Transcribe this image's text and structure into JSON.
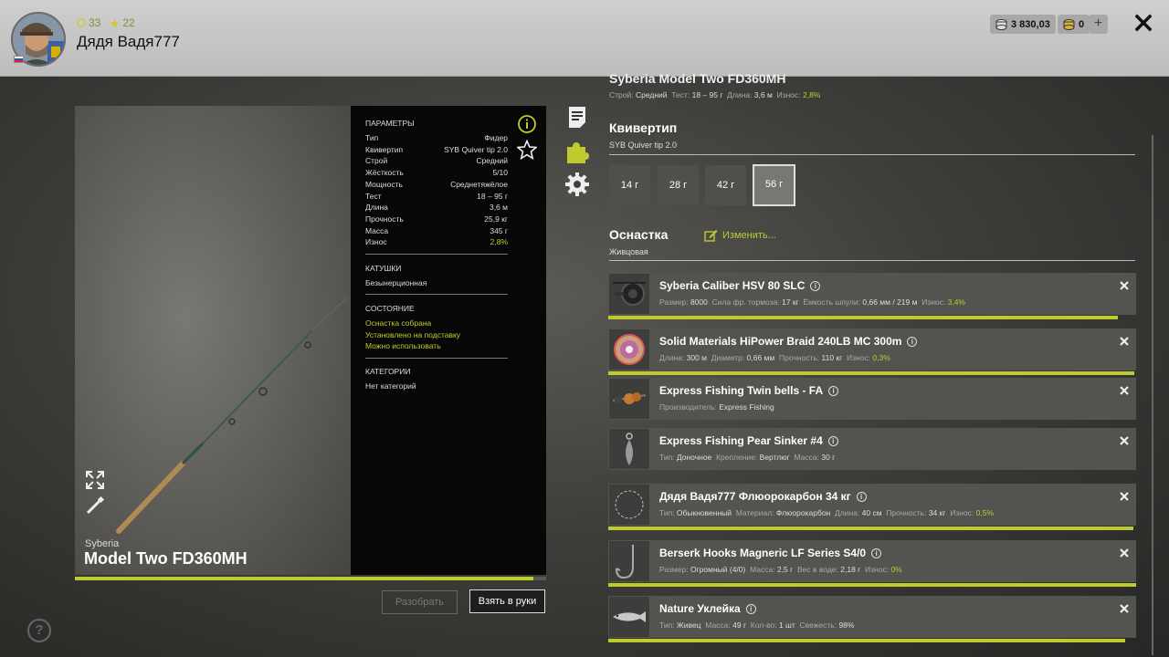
{
  "profile": {
    "username": "Дядя Вадя777",
    "level": "33",
    "rank": "22"
  },
  "currency": {
    "silver": "3 830,03",
    "gold": "0"
  },
  "rod": {
    "brand": "Syberia",
    "model": "Model Two FD360MH",
    "full_title": "Syberia Model Two FD360MH",
    "condition_fraction": 0.972,
    "meta": {
      "stroy_label": "Строй:",
      "stroy_value": "Средний",
      "test_label": "Тест:",
      "test_value": "18 – 95 г",
      "length_label": "Длина:",
      "length_value": "3,6 м",
      "wear_label": "Износ:",
      "wear_value": "2,8%"
    }
  },
  "params": {
    "title": "ПАРАМЕТРЫ",
    "rows": [
      {
        "k": "Тип",
        "v": "Фидер"
      },
      {
        "k": "Квивертип",
        "v": "SYB Quiver tip 2.0"
      },
      {
        "k": "Строй",
        "v": "Средний"
      },
      {
        "k": "Жёсткость",
        "v": "5/10"
      },
      {
        "k": "Мощность",
        "v": "Среднетяжёлое"
      },
      {
        "k": "Тест",
        "v": "18 – 95 г"
      },
      {
        "k": "Длина",
        "v": "3,6 м"
      },
      {
        "k": "Прочность",
        "v": "25,9 кг"
      },
      {
        "k": "Масса",
        "v": "345 г"
      },
      {
        "k": "Износ",
        "v": "2,8%"
      }
    ],
    "reels_title": "КАТУШКИ",
    "reels_value": "Безынерционная",
    "state_title": "СОСТОЯНИЕ",
    "state_items": [
      "Оснастка собрана",
      "Установлено на подставку",
      "Можно использовать"
    ],
    "cat_title": "КАТЕГОРИИ",
    "cat_value": "Нет категорий"
  },
  "buttons": {
    "disassemble": "Разобрать",
    "take": "Взять в руки"
  },
  "quiver": {
    "title": "Квивертип",
    "name": "SYB Quiver tip 2.0",
    "tips": [
      "14 г",
      "28 г",
      "42 г",
      "56 г"
    ],
    "selected_index": 3
  },
  "rig": {
    "title": "Оснастка",
    "type": "Живцовая",
    "change_label": "Изменить..."
  },
  "items": [
    {
      "name": "Syberia Caliber HSV 80 SLC",
      "meta": [
        [
          "Размер:",
          "8000"
        ],
        [
          "Сила фр. тормоза:",
          "17 кг"
        ],
        [
          "Ёмкость шпули:",
          "0,66 мм / 219 м"
        ],
        [
          "Износ:",
          "3,4%"
        ]
      ],
      "progress": 0.966,
      "icon": "reel-icon"
    },
    {
      "name": "Solid Materials HiPower Braid 240LB MC 300m",
      "meta": [
        [
          "Длина:",
          "300 м"
        ],
        [
          "Диаметр:",
          "0,66 мм"
        ],
        [
          "Прочность:",
          "110 кг"
        ],
        [
          "Износ:",
          "0,3%"
        ]
      ],
      "progress": 0.997,
      "icon": "line-spool-icon"
    },
    {
      "name": "Express Fishing Twin bells - FA",
      "meta": [
        [
          "Производитель:",
          "Express Fishing"
        ]
      ],
      "progress": null,
      "icon": "bells-icon"
    },
    {
      "name": "Express Fishing Pear Sinker #4",
      "meta": [
        [
          "Тип:",
          "Доночное"
        ],
        [
          "Крепление:",
          "Вертлюг"
        ],
        [
          "Масса:",
          "30 г"
        ]
      ],
      "progress": null,
      "icon": "sinker-icon"
    },
    {
      "name": "Дядя Вадя777 Флюорокарбон 34 кг",
      "meta": [
        [
          "Тип:",
          "Обыкновенный"
        ],
        [
          "Материал:",
          "Флюорокарбон"
        ],
        [
          "Длина:",
          "40 см"
        ],
        [
          "Прочность:",
          "34 кг"
        ],
        [
          "Износ:",
          "0,5%"
        ]
      ],
      "progress": 0.995,
      "icon": "leader-icon"
    },
    {
      "name": "Berserk Hooks Magneric LF Series S4/0",
      "meta": [
        [
          "Размер:",
          "Огромный (4/0)"
        ],
        [
          "Масса:",
          "2,5 г"
        ],
        [
          "Вес в воде:",
          "2,18 г"
        ],
        [
          "Износ:",
          "0%"
        ]
      ],
      "progress": 1.0,
      "icon": "hook-icon"
    },
    {
      "name": "Nature Уклейка",
      "meta": [
        [
          "Тип:",
          "Живец"
        ],
        [
          "Масса:",
          "49 г"
        ],
        [
          "Кол-во:",
          "1 шт"
        ],
        [
          "Свежесть:",
          "98%"
        ]
      ],
      "progress": 0.98,
      "icon": "fish-bait-icon"
    }
  ],
  "colors": {
    "accent": "#bfcb2d"
  }
}
